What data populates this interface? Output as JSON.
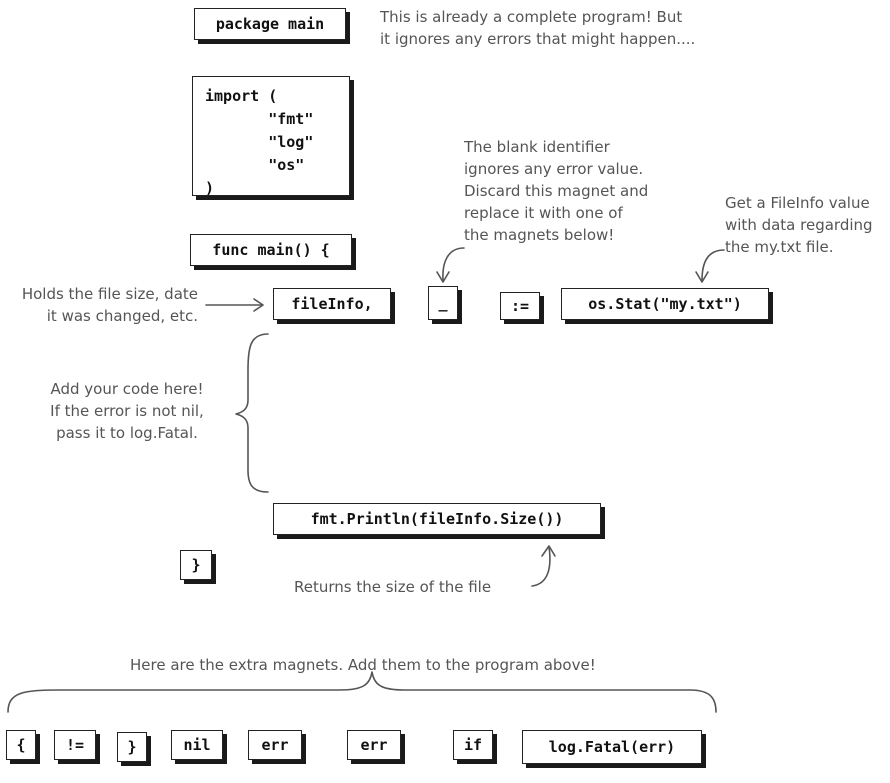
{
  "program": {
    "package_line": "package main",
    "import_lines": [
      "import (",
      "       \"fmt\"",
      "       \"log\"",
      "       \"os\"",
      ")"
    ],
    "func_line": "func main() {",
    "file_info": "fileInfo,",
    "blank": "_",
    "assign": ":=",
    "stat_call": "os.Stat(\"my.txt\")",
    "println": "fmt.Println(fileInfo.Size())",
    "close_brace": "}"
  },
  "notes": {
    "complete_program": "This is already a complete program! But\nit ignores any errors that might happen....",
    "blank_identifier": "The blank identifier\nignores any error value.\nDiscard this magnet and\nreplace it with one of\nthe magnets below!",
    "fileinfo_value": "Get a FileInfo value\nwith data regarding\nthe my.txt file.",
    "holds_size": "Holds the file size, date\nit was changed, etc.",
    "add_code": "Add your code here!\nIf the error is not nil,\npass it to log.Fatal.",
    "returns_size": "Returns the size of the file",
    "extra_magnets": "Here are the extra magnets. Add them to the program above!"
  },
  "extra_magnets": [
    "{",
    "!=",
    "}",
    "nil",
    "err",
    "err",
    "if",
    "log.Fatal(err)"
  ]
}
